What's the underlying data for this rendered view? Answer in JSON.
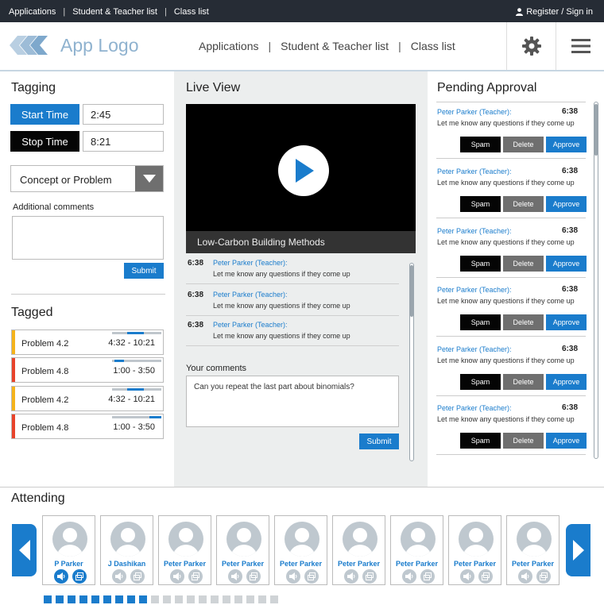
{
  "topbar": {
    "links": [
      "Applications",
      "Student & Teacher list",
      "Class list"
    ],
    "separator": "|",
    "register": "Register / Sign in"
  },
  "header": {
    "logo_text": "App Logo",
    "nav": [
      "Applications",
      "Student & Teacher list",
      "Class list"
    ],
    "separator": "|"
  },
  "tagging": {
    "title": "Tagging",
    "start_label": "Start Time",
    "start_value": "2:45",
    "stop_label": "Stop Time",
    "stop_value": "8:21",
    "select_value": "Concept or Problem",
    "comments_label": "Additional comments",
    "comments_value": "",
    "submit": "Submit"
  },
  "tagged": {
    "title": "Tagged",
    "items": [
      {
        "name": "Problem 4.2",
        "range": "4:32 - 10:21",
        "color": "#f5b31b",
        "progress_start": 0.3,
        "progress_end": 0.65
      },
      {
        "name": "Problem 4.8",
        "range": "1:00 - 3:50",
        "color": "#e8432b",
        "progress_start": 0.05,
        "progress_end": 0.25
      },
      {
        "name": "Problem 4.2",
        "range": "4:32 - 10:21",
        "color": "#f5b31b",
        "progress_start": 0.3,
        "progress_end": 0.65
      },
      {
        "name": "Problem 4.8",
        "range": "1:00 - 3:50",
        "color": "#e8432b",
        "progress_start": 0.75,
        "progress_end": 1.0
      }
    ]
  },
  "live": {
    "title": "Live View",
    "video_title": "Low-Carbon Building Methods",
    "messages": [
      {
        "time": "6:38",
        "name": "Peter Parker (Teacher):",
        "text": "Let me know any questions if they come up"
      },
      {
        "time": "6:38",
        "name": "Peter Parker (Teacher):",
        "text": "Let me know any questions if they come up"
      },
      {
        "time": "6:38",
        "name": "Peter Parker (Teacher):",
        "text": "Let me know any questions if they come up"
      }
    ],
    "comments_label": "Your comments",
    "comments_value": "Can you repeat the last part about binomials?",
    "submit": "Submit"
  },
  "pending": {
    "title": "Pending Approval",
    "spam": "Spam",
    "delete": "Delete",
    "approve": "Approve",
    "items": [
      {
        "name": "Peter Parker (Teacher):",
        "time": "6:38",
        "text": "Let me know any questions if they come up"
      },
      {
        "name": "Peter Parker (Teacher):",
        "time": "6:38",
        "text": "Let me know any questions if they come up"
      },
      {
        "name": "Peter Parker (Teacher):",
        "time": "6:38",
        "text": "Let me know any questions if they come up"
      },
      {
        "name": "Peter Parker (Teacher):",
        "time": "6:38",
        "text": "Let me know any questions if they come up"
      },
      {
        "name": "Peter Parker (Teacher):",
        "time": "6:38",
        "text": "Let me know any questions if they come up"
      },
      {
        "name": "Peter Parker (Teacher):",
        "time": "6:38",
        "text": "Let me know any questions if they come up"
      }
    ]
  },
  "attending": {
    "title": "Attending",
    "people": [
      {
        "name": "P Parker",
        "active": true
      },
      {
        "name": "J Dashikan",
        "active": false
      },
      {
        "name": "Peter Parker",
        "active": false
      },
      {
        "name": "Peter Parker",
        "active": false
      },
      {
        "name": "Peter Parker",
        "active": false
      },
      {
        "name": "Peter Parker",
        "active": false
      },
      {
        "name": "Peter Parker",
        "active": false
      },
      {
        "name": "Peter Parker",
        "active": false
      },
      {
        "name": "Peter Parker",
        "active": false
      }
    ],
    "pages_total": 20,
    "pages_active": 9
  },
  "colors": {
    "accent": "#1a7ccc",
    "dark": "#262c35",
    "gray": "#6f6f6f",
    "inactive": "#cfd3d6"
  },
  "icons": {
    "gear": "gear-icon",
    "menu": "hamburger-menu-icon",
    "user": "user-icon",
    "play": "play-icon",
    "prev": "chevron-left-icon",
    "next": "chevron-right-icon"
  }
}
